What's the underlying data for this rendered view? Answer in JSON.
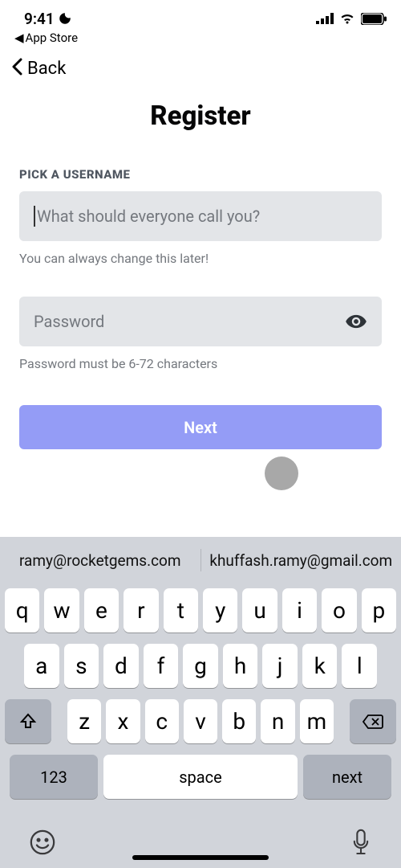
{
  "statusBar": {
    "time": "9:41",
    "appStoreBack": "App Store"
  },
  "nav": {
    "back": "Back"
  },
  "page": {
    "title": "Register"
  },
  "form": {
    "usernameLabel": "PICK A USERNAME",
    "usernamePlaceholder": "What should everyone call you?",
    "usernameHelper": "You can always change this later!",
    "passwordPlaceholder": "Password",
    "passwordHelper": "Password must be 6-72 characters",
    "nextButton": "Next"
  },
  "keyboard": {
    "suggestions": [
      "ramy@rocketgems.com",
      "khuffash.ramy@gmail.com"
    ],
    "row1": [
      "q",
      "w",
      "e",
      "r",
      "t",
      "y",
      "u",
      "i",
      "o",
      "p"
    ],
    "row2": [
      "a",
      "s",
      "d",
      "f",
      "g",
      "h",
      "j",
      "k",
      "l"
    ],
    "row3": [
      "z",
      "x",
      "c",
      "v",
      "b",
      "n",
      "m"
    ],
    "numKey": "123",
    "spaceKey": "space",
    "goKey": "next"
  }
}
